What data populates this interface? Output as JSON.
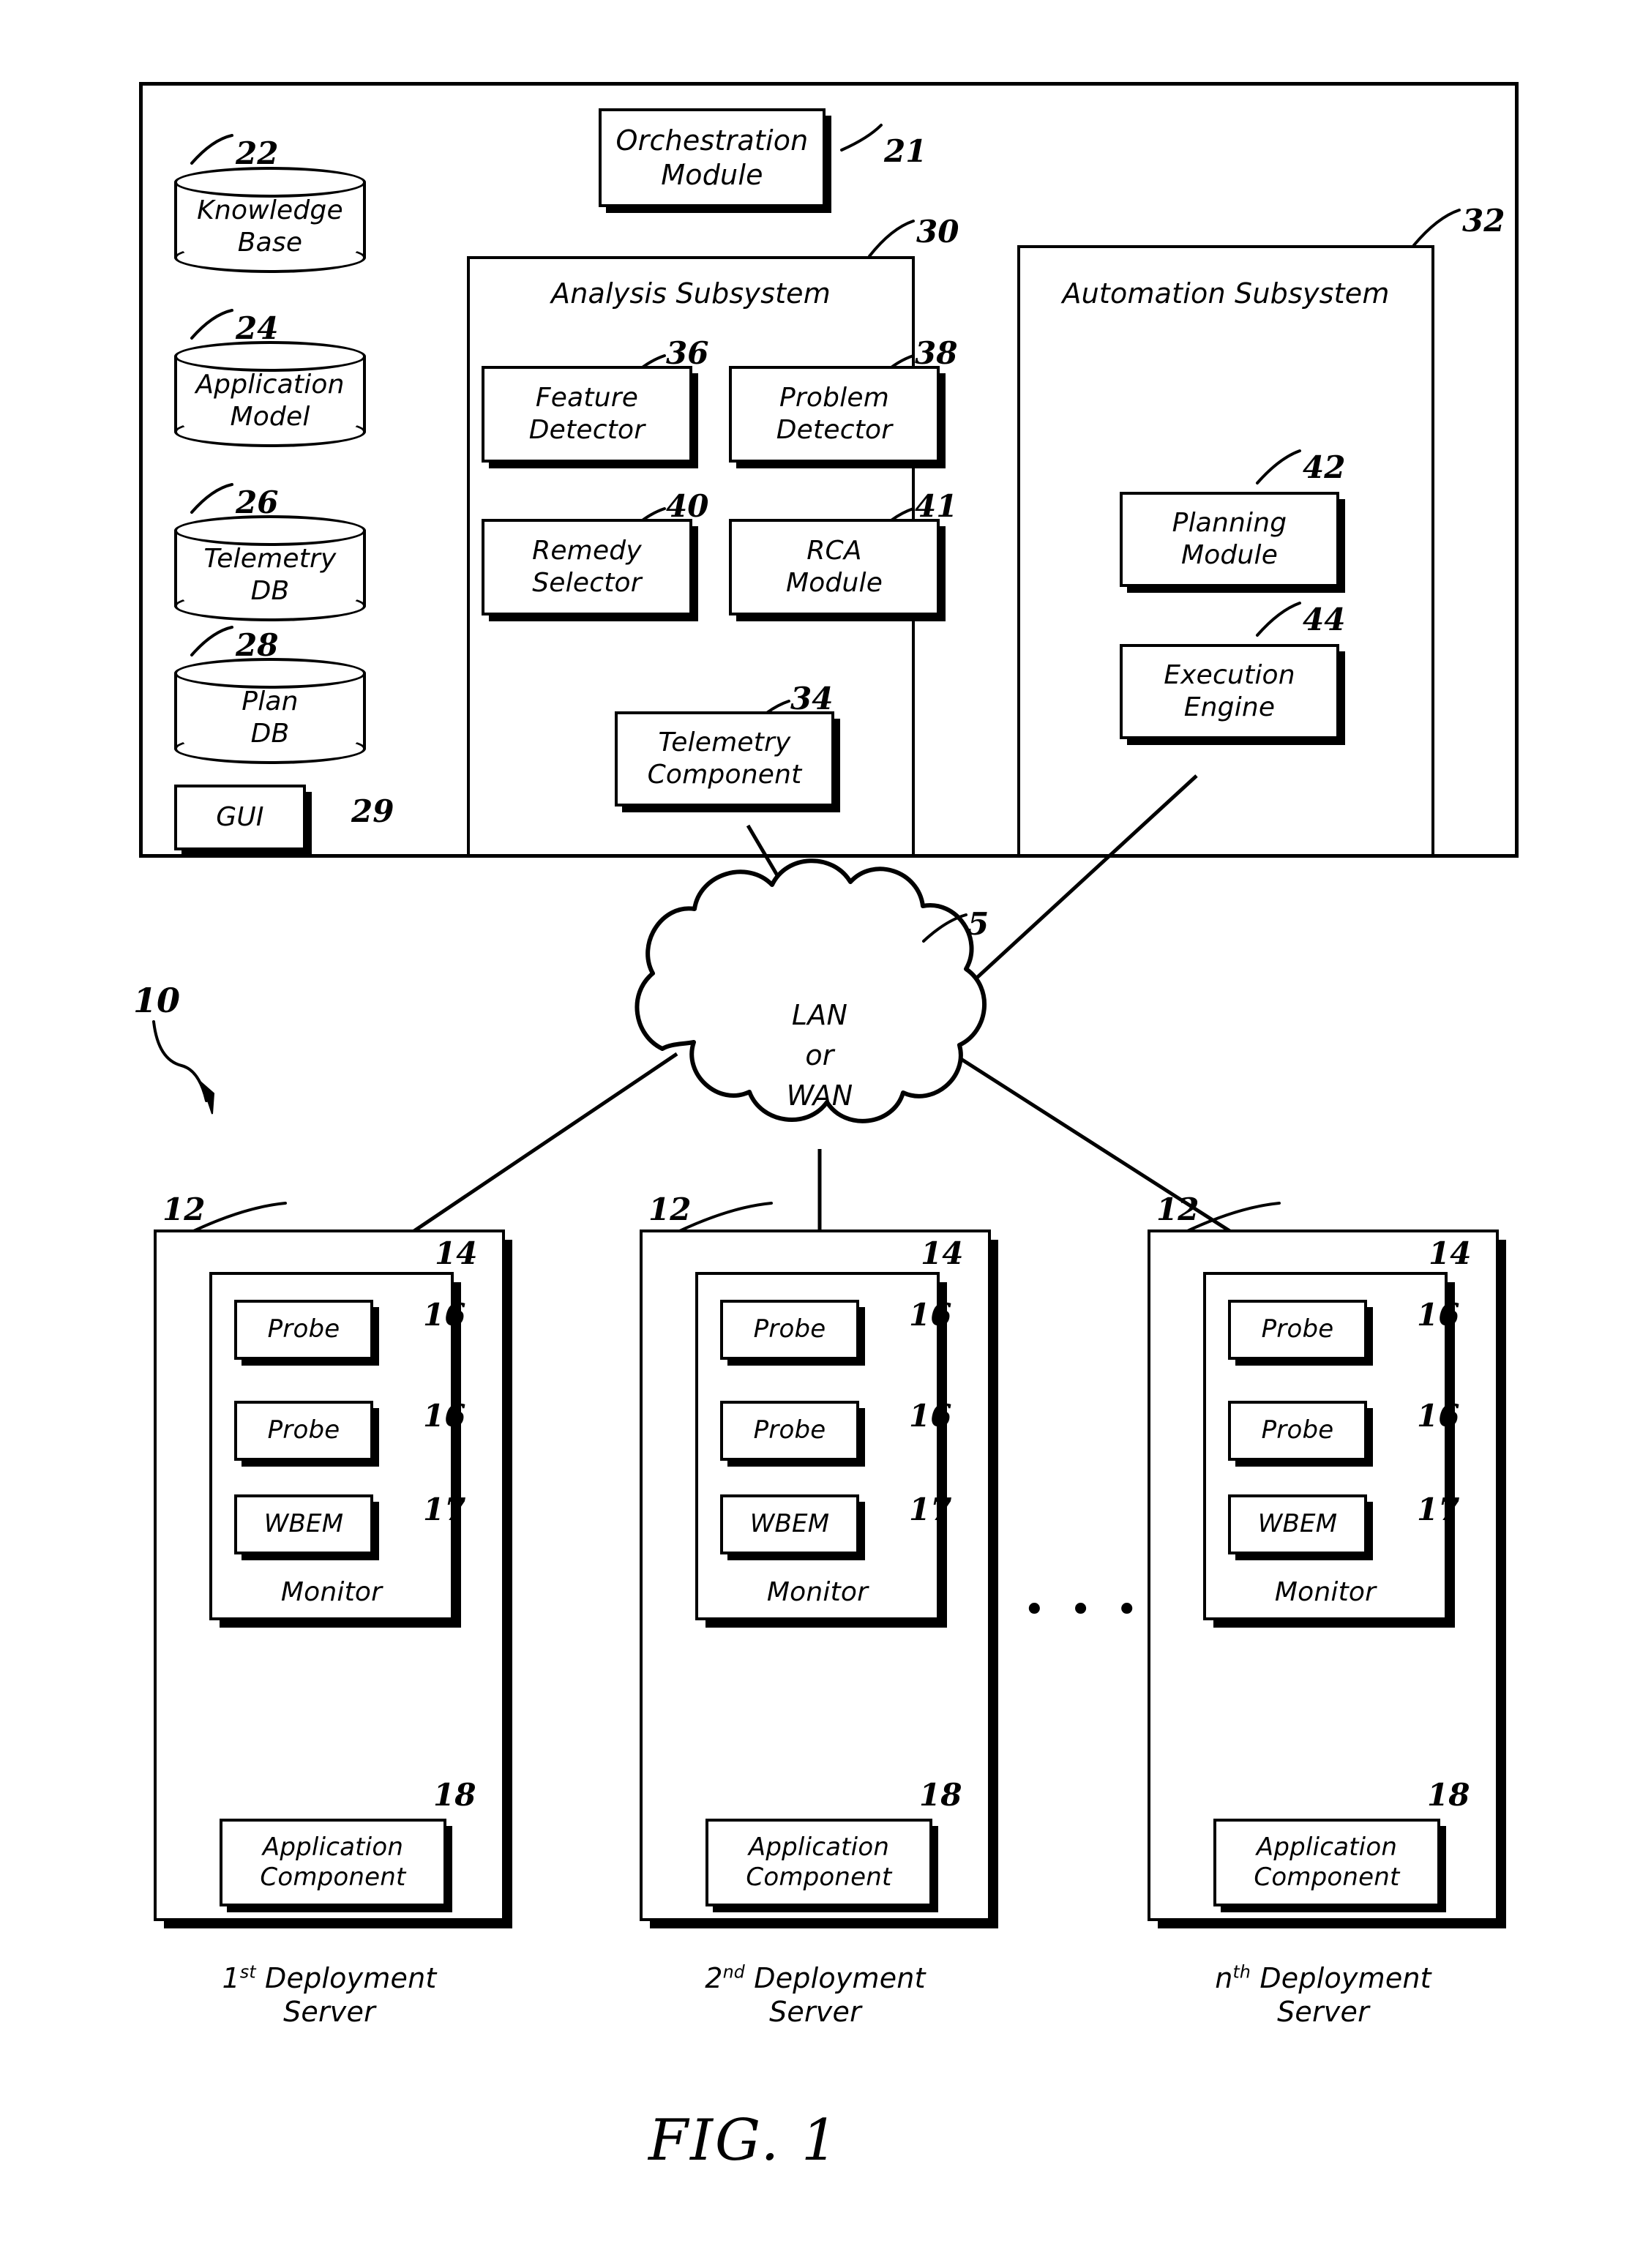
{
  "figure": {
    "caption": "FIG. 1",
    "system_ref": "10"
  },
  "management_system": {
    "ref": "",
    "orchestration_module": {
      "label": "Orchestration\nModule",
      "ref": "21"
    },
    "datastores": [
      {
        "label": "Knowledge\nBase",
        "ref": "22"
      },
      {
        "label": "Application\nModel",
        "ref": "24"
      },
      {
        "label": "Telemetry\nDB",
        "ref": "26"
      },
      {
        "label": "Plan\nDB",
        "ref": "28"
      }
    ],
    "gui": {
      "label": "GUI",
      "ref": "29"
    },
    "analysis_subsystem": {
      "title": "Analysis Subsystem",
      "ref": "30",
      "modules": [
        {
          "label": "Feature\nDetector",
          "ref": "36"
        },
        {
          "label": "Problem\nDetector",
          "ref": "38"
        },
        {
          "label": "Remedy\nSelector",
          "ref": "40"
        },
        {
          "label": "RCA\nModule",
          "ref": "41"
        },
        {
          "label": "Telemetry\nComponent",
          "ref": "34"
        }
      ]
    },
    "automation_subsystem": {
      "title": "Automation Subsystem",
      "ref": "32",
      "modules": [
        {
          "label": "Planning\nModule",
          "ref": "42"
        },
        {
          "label": "Execution\nEngine",
          "ref": "44"
        }
      ]
    }
  },
  "network": {
    "label": "LAN\nor\nWAN",
    "ref": "5"
  },
  "servers": [
    {
      "caption_ordinal": "1",
      "caption_suffix": "st",
      "caption_rest": " Deployment\nServer",
      "server_ref": "12",
      "monitor": {
        "label": "Monitor",
        "ref": "14",
        "agents": [
          {
            "label": "Probe",
            "ref": "16"
          },
          {
            "label": "Probe",
            "ref": "16"
          },
          {
            "label": "WBEM",
            "ref": "17"
          }
        ]
      },
      "application_component": {
        "label": "Application\nComponent",
        "ref": "18"
      }
    },
    {
      "caption_ordinal": "2",
      "caption_suffix": "nd",
      "caption_rest": " Deployment\nServer",
      "server_ref": "12",
      "monitor": {
        "label": "Monitor",
        "ref": "14",
        "agents": [
          {
            "label": "Probe",
            "ref": "16"
          },
          {
            "label": "Probe",
            "ref": "16"
          },
          {
            "label": "WBEM",
            "ref": "17"
          }
        ]
      },
      "application_component": {
        "label": "Application\nComponent",
        "ref": "18"
      }
    },
    {
      "caption_ordinal": "n",
      "caption_suffix": "th",
      "caption_rest": " Deployment\nServer",
      "server_ref": "12",
      "monitor": {
        "label": "Monitor",
        "ref": "14",
        "agents": [
          {
            "label": "Probe",
            "ref": "16"
          },
          {
            "label": "Probe",
            "ref": "16"
          },
          {
            "label": "WBEM",
            "ref": "17"
          }
        ]
      },
      "application_component": {
        "label": "Application\nComponent",
        "ref": "18"
      }
    }
  ],
  "ellipsis": "• • •",
  "colors": {
    "ink": "#000000",
    "paper": "#ffffff"
  }
}
